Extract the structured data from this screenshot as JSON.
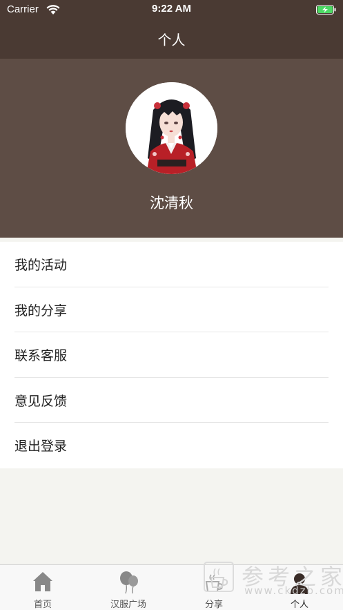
{
  "status_bar": {
    "carrier": "Carrier",
    "time": "9:22 AM",
    "wifi_icon": "wifi-icon",
    "battery_icon": "battery-charging-icon",
    "battery_color": "#4cd964"
  },
  "nav": {
    "title": "个人"
  },
  "profile": {
    "name": "沈清秋",
    "avatar_icon": "avatar-illustration",
    "header_color": "#5e4d45"
  },
  "menu": {
    "items": [
      {
        "label": "我的活动"
      },
      {
        "label": "我的分享"
      },
      {
        "label": "联系客服"
      },
      {
        "label": "意见反馈"
      },
      {
        "label": "退出登录"
      }
    ]
  },
  "tab_bar": {
    "tabs": [
      {
        "label": "首页",
        "icon": "home-icon"
      },
      {
        "label": "汉服广场",
        "icon": "balloons-icon"
      },
      {
        "label": "分享",
        "icon": "share-cup-icon"
      },
      {
        "label": "个人",
        "icon": "person-icon",
        "active": true
      }
    ]
  },
  "watermark": {
    "title": "参考之家",
    "url": "www.ckdzb.com"
  },
  "colors": {
    "nav_bg": "#4a3a33",
    "header_bg": "#5e4d45",
    "page_bg": "#f4f4f0"
  }
}
